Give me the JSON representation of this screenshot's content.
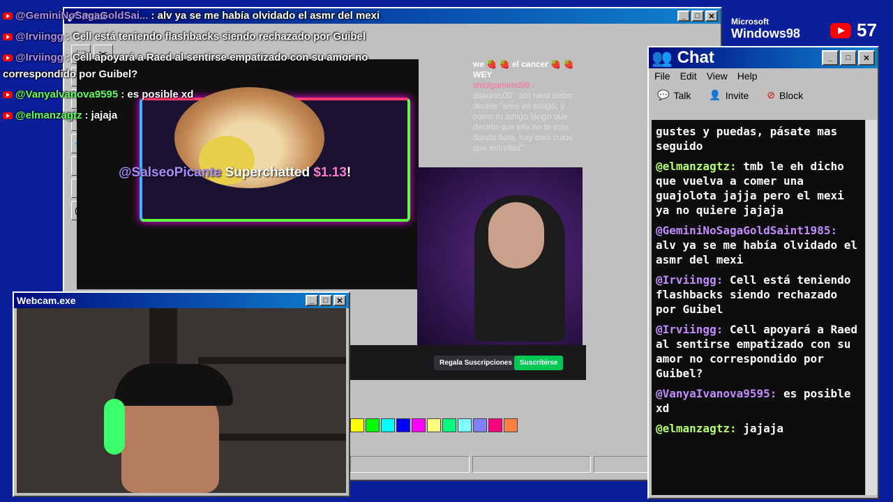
{
  "overlay_chat": [
    {
      "user": "@GeminiNoSagaGoldSai...",
      "text": ": alv ya se me había olvidado el asmr del mexi"
    },
    {
      "user": "@Irviingg",
      "text": ": Cell está teniendo flashbacks siendo rechazado por Guibel"
    },
    {
      "user": "@Irviingg",
      "text": ": Cell apoyará a Raed al sentirse empatizado con su amor no"
    },
    {
      "user": "",
      "text": "correspondido por Guibel?"
    },
    {
      "user": "@Vanyalvanova9595",
      "text": ": es posible xd"
    },
    {
      "user": "@elmanzagtz",
      "text": ": jajaja"
    }
  ],
  "paint": {
    "title": "Paint"
  },
  "superchat": {
    "name": "@SalseoPicante",
    "action": " Superchatted ",
    "amount": "$1.13",
    "end": "!"
  },
  "stream_chat_mini": {
    "line1": "we 🍓 🍓 el cancer 🍓 🍓 WEY",
    "line2": "shioigamired98 :",
    "line3": "dakuras00 : ahí raed debio decirle \"eres mi amigo, y como tu amigo tengo que decirte que ella no te esta dando bola, hay mas culos que estrellas\""
  },
  "twitch": {
    "regala": "Regala Suscripciones",
    "suscribe": "Suscribirse"
  },
  "chat_window": {
    "title": "Chat",
    "menu": [
      "File",
      "Edit",
      "View",
      "Help"
    ],
    "toolbar": [
      "Talk",
      "Invite",
      "Block"
    ],
    "messages": [
      {
        "user": "",
        "text": "gustes y puedas, pásate mas seguido"
      },
      {
        "user": "@elmanzagtz:",
        "text": " tmb le eh dicho que vuelva a comer una guajolota jajja pero el mexi ya no quiere jajaja"
      },
      {
        "user": "@GeminiNoSagaGoldSaint1985:",
        "text": " alv ya se me había olvidado el asmr del mexi"
      },
      {
        "user": "@Irviingg:",
        "text": " Cell está teniendo flashbacks siendo rechazado por Guibel"
      },
      {
        "user": "@Irviingg:",
        "text": " Cell apoyará a Raed al sentirse empatizado con su amor no correspondido por Guibel?"
      },
      {
        "user": "@VanyaIvanova9595:",
        "text": " es posible xd"
      },
      {
        "user": "@elmanzagtz:",
        "text": " jajaja"
      }
    ],
    "user_colors": [
      "#ffffff",
      "#b6ff6b",
      "#c38cff",
      "#c38cff",
      "#c38cff",
      "#c38cff",
      "#b6ff6b"
    ]
  },
  "webcam": {
    "title": "Webcam.exe"
  },
  "branding": {
    "microsoft": "Microsoft",
    "windows": "Windows98",
    "viewers": "57"
  },
  "colors": {
    "desktop": "#0a1f9c",
    "title_start": "#000a80",
    "title_end": "#1084d0"
  }
}
